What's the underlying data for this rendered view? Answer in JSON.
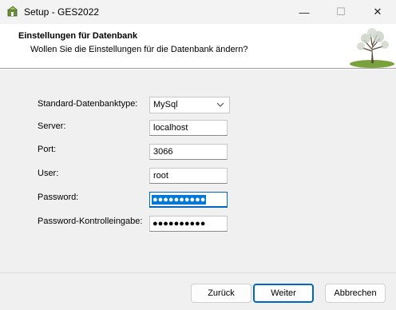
{
  "window": {
    "title": "Setup - GES2022",
    "minimize_glyph": "—",
    "maximize_glyph": "☐",
    "close_glyph": "✕"
  },
  "header": {
    "title": "Einstellungen für Datenbank",
    "subtitle": "Wollen Sie die Einstellungen für die Datenbank ändern?"
  },
  "form": {
    "dbtype_label": "Standard-Datenbanktype:",
    "dbtype_value": "MySql",
    "server_label": "Server:",
    "server_value": "localhost",
    "port_label": "Port:",
    "port_value": "3066",
    "user_label": "User:",
    "user_value": "root",
    "password_label": "Password:",
    "password_value": "●●●●●●●●●●",
    "password_confirm_label": "Password-Kontrolleingabe:",
    "password_confirm_value": "●●●●●●●●●●"
  },
  "buttons": {
    "back": "Zurück",
    "next": "Weiter",
    "cancel": "Abbrechen"
  }
}
